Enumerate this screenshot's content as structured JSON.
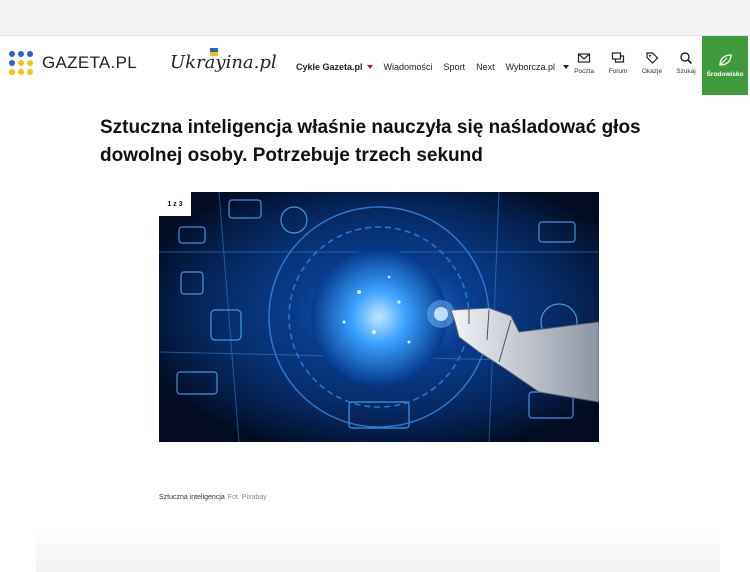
{
  "header": {
    "logo_text": "GAZETA.PL",
    "partner_logo_text": "Ukrayina.pl",
    "nav": [
      {
        "label": "Cykle Gazeta.pl",
        "bold": true,
        "dropdown": "red"
      },
      {
        "label": "Wiadomości"
      },
      {
        "label": "Sport"
      },
      {
        "label": "Next"
      },
      {
        "label": "Wyborcza.pl",
        "dropdown": "dark"
      }
    ],
    "tools": [
      {
        "label": "Poczta",
        "icon": "mail-icon"
      },
      {
        "label": "Forum",
        "icon": "forum-icon"
      },
      {
        "label": "Okazje",
        "icon": "tag-icon"
      },
      {
        "label": "Szukaj",
        "icon": "search-icon"
      }
    ],
    "eco_label": "Środowisko",
    "eco_icon": "leaf-icon"
  },
  "article": {
    "title": "Sztuczna inteligencja właśnie nauczyła się naśladować głos dowolnej osoby. Potrzebuje trzech sekund",
    "gallery_counter": "1 z 3",
    "caption": "Sztuczna inteligencja",
    "credit": "Fot. Pixabay"
  },
  "colors": {
    "accent_red": "#c8102e",
    "eco_green": "#3e9a3a",
    "logo_dot_blue": "#2a64c4",
    "logo_dot_yellow": "#f2c40c"
  }
}
